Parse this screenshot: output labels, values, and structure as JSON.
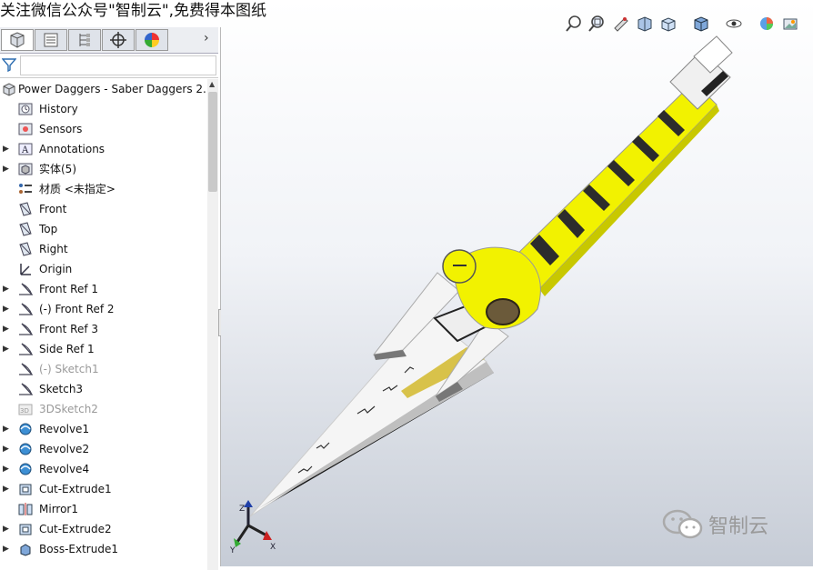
{
  "banner": {
    "text": "关注微信公众号\"智制云\",免费得本图纸"
  },
  "panel": {
    "tabs": [
      {
        "name": "feature-manager-tab",
        "icon": "feature-tree-icon",
        "active": true
      },
      {
        "name": "property-manager-tab",
        "icon": "property-list-icon",
        "active": false
      },
      {
        "name": "configuration-manager-tab",
        "icon": "configuration-icon",
        "active": false
      },
      {
        "name": "dimxpert-tab",
        "icon": "crosshair-icon",
        "active": false
      },
      {
        "name": "display-manager-tab",
        "icon": "color-wheel-icon",
        "active": false
      }
    ],
    "filter_icon": "filter-icon"
  },
  "tree": {
    "root": "Power Daggers - Saber Daggers 2.",
    "items": [
      {
        "label": "History",
        "icon": "history-folder-icon",
        "expander": false,
        "dim": false
      },
      {
        "label": "Sensors",
        "icon": "sensors-folder-icon",
        "expander": false,
        "dim": false
      },
      {
        "label": "Annotations",
        "icon": "annotations-icon",
        "expander": true,
        "dim": false
      },
      {
        "label": "实体(5)",
        "icon": "solid-bodies-icon",
        "expander": true,
        "dim": false
      },
      {
        "label": "材质 <未指定>",
        "icon": "material-icon",
        "expander": false,
        "dim": false
      },
      {
        "label": "Front",
        "icon": "plane-icon",
        "expander": false,
        "dim": false
      },
      {
        "label": "Top",
        "icon": "plane-icon",
        "expander": false,
        "dim": false
      },
      {
        "label": "Right",
        "icon": "plane-icon",
        "expander": false,
        "dim": false
      },
      {
        "label": "Origin",
        "icon": "origin-icon",
        "expander": false,
        "dim": false
      },
      {
        "label": "Front Ref 1",
        "icon": "sketch-icon",
        "expander": true,
        "dim": false
      },
      {
        "label": "(-) Front Ref 2",
        "icon": "sketch-icon",
        "expander": true,
        "dim": false
      },
      {
        "label": "Front Ref 3",
        "icon": "sketch-icon",
        "expander": true,
        "dim": false
      },
      {
        "label": "Side Ref 1",
        "icon": "sketch-icon",
        "expander": true,
        "dim": false
      },
      {
        "label": "(-) Sketch1",
        "icon": "sketch-icon",
        "expander": false,
        "dim": true
      },
      {
        "label": "Sketch3",
        "icon": "sketch-icon",
        "expander": false,
        "dim": false
      },
      {
        "label": "3DSketch2",
        "icon": "3dsketch-icon",
        "expander": false,
        "dim": true
      },
      {
        "label": "Revolve1",
        "icon": "revolve-icon",
        "expander": true,
        "dim": false
      },
      {
        "label": "Revolve2",
        "icon": "revolve-icon",
        "expander": true,
        "dim": false
      },
      {
        "label": "Revolve4",
        "icon": "revolve-icon",
        "expander": true,
        "dim": false
      },
      {
        "label": "Cut-Extrude1",
        "icon": "cut-extrude-icon",
        "expander": true,
        "dim": false
      },
      {
        "label": "Mirror1",
        "icon": "mirror-icon",
        "expander": false,
        "dim": false
      },
      {
        "label": "Cut-Extrude2",
        "icon": "cut-extrude-icon",
        "expander": true,
        "dim": false
      },
      {
        "label": "Boss-Extrude1",
        "icon": "boss-extrude-icon",
        "expander": true,
        "dim": false
      }
    ]
  },
  "viewport": {
    "heads_up_icons": [
      "zoom-to-fit-icon",
      "zoom-area-icon",
      "previous-view-icon",
      "section-view-icon",
      "view-orientation-icon",
      "display-style-icon",
      "hide-show-icon",
      "edit-appearance-icon",
      "apply-scene-icon"
    ],
    "axis_labels": {
      "z": "Z",
      "y": "Y",
      "x": "X"
    },
    "watermark": "智制云",
    "colors": {
      "handle_yellow": "#f2f200",
      "blade": "#f5f5f5",
      "band": "#2c2c2c"
    }
  }
}
